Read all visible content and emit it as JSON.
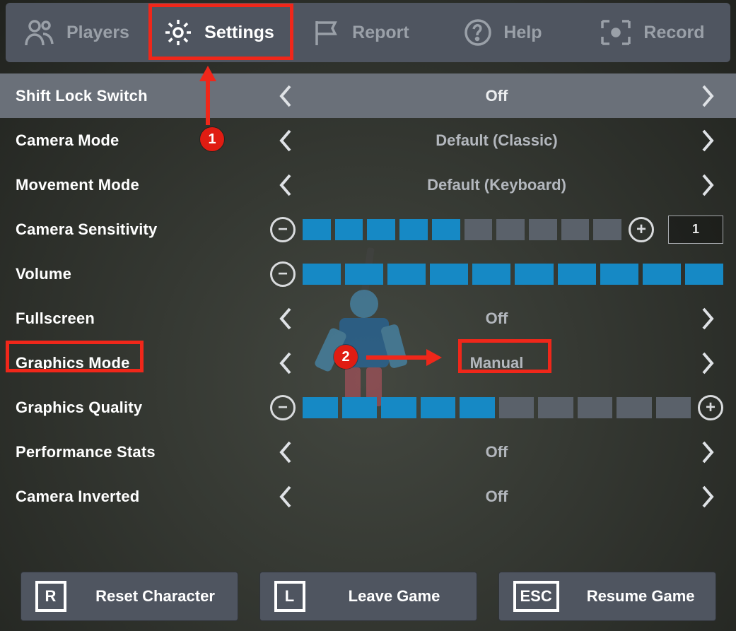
{
  "tabs": {
    "players": "Players",
    "settings": "Settings",
    "report": "Report",
    "help": "Help",
    "record": "Record"
  },
  "settings": {
    "shiftLock": {
      "label": "Shift Lock Switch",
      "value": "Off"
    },
    "cameraMode": {
      "label": "Camera Mode",
      "value": "Default (Classic)"
    },
    "movementMode": {
      "label": "Movement Mode",
      "value": "Default (Keyboard)"
    },
    "cameraSensitivity": {
      "label": "Camera Sensitivity",
      "filled": 5,
      "total": 10,
      "value": "1"
    },
    "volume": {
      "label": "Volume",
      "filled": 10,
      "total": 10
    },
    "fullscreen": {
      "label": "Fullscreen",
      "value": "Off"
    },
    "graphicsMode": {
      "label": "Graphics Mode",
      "value": "Manual"
    },
    "graphicsQuality": {
      "label": "Graphics Quality",
      "filled": 5,
      "total": 10
    },
    "performanceStats": {
      "label": "Performance Stats",
      "value": "Off"
    },
    "cameraInverted": {
      "label": "Camera Inverted",
      "value": "Off"
    }
  },
  "footer": {
    "reset": {
      "key": "R",
      "label": "Reset Character"
    },
    "leave": {
      "key": "L",
      "label": "Leave Game"
    },
    "resume": {
      "key": "ESC",
      "label": "Resume Game"
    }
  },
  "annotations": {
    "badge1": "1",
    "badge2": "2"
  }
}
